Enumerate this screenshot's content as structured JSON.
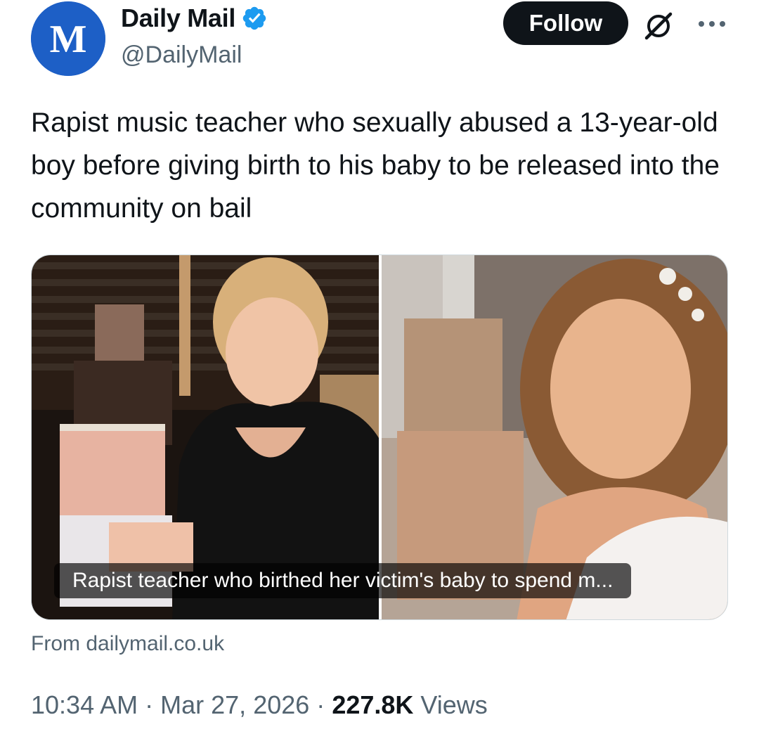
{
  "author": {
    "display_name": "Daily Mail",
    "handle": "@DailyMail",
    "avatar_text": "M",
    "avatar_color": "#1d5fc6",
    "verified_color": "#1d9bf0"
  },
  "header": {
    "follow_label": "Follow",
    "grok_icon": "grok-icon",
    "more_icon": "more-icon"
  },
  "tweet": {
    "text": "Rapist music teacher who sexually abused a 13-year-old boy before giving birth to his baby to be released into the community on bail"
  },
  "media": {
    "caption": "Rapist teacher who birthed her victim's baby to spend m...",
    "source": "From dailymail.co.uk"
  },
  "meta": {
    "time": "10:34 AM",
    "separator": "·",
    "date": "Mar 27, 2026",
    "views_count": "227.8K",
    "views_label": "Views"
  }
}
